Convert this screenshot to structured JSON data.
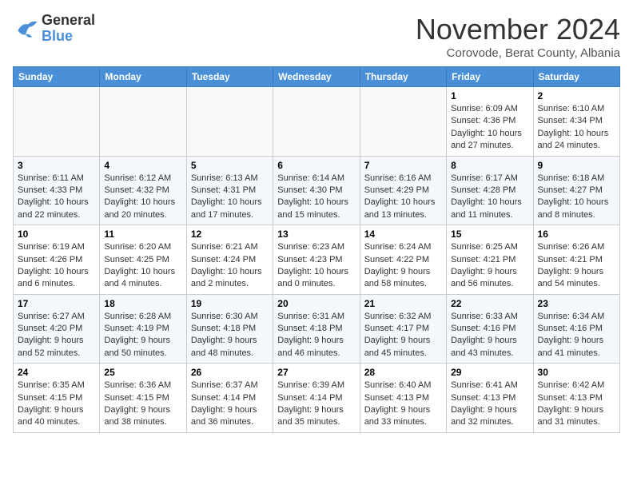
{
  "logo": {
    "line1": "General",
    "line2": "Blue"
  },
  "title": "November 2024",
  "subtitle": "Corovode, Berat County, Albania",
  "weekdays": [
    "Sunday",
    "Monday",
    "Tuesday",
    "Wednesday",
    "Thursday",
    "Friday",
    "Saturday"
  ],
  "weeks": [
    [
      {
        "day": "",
        "info": ""
      },
      {
        "day": "",
        "info": ""
      },
      {
        "day": "",
        "info": ""
      },
      {
        "day": "",
        "info": ""
      },
      {
        "day": "",
        "info": ""
      },
      {
        "day": "1",
        "info": "Sunrise: 6:09 AM\nSunset: 4:36 PM\nDaylight: 10 hours and 27 minutes."
      },
      {
        "day": "2",
        "info": "Sunrise: 6:10 AM\nSunset: 4:34 PM\nDaylight: 10 hours and 24 minutes."
      }
    ],
    [
      {
        "day": "3",
        "info": "Sunrise: 6:11 AM\nSunset: 4:33 PM\nDaylight: 10 hours and 22 minutes."
      },
      {
        "day": "4",
        "info": "Sunrise: 6:12 AM\nSunset: 4:32 PM\nDaylight: 10 hours and 20 minutes."
      },
      {
        "day": "5",
        "info": "Sunrise: 6:13 AM\nSunset: 4:31 PM\nDaylight: 10 hours and 17 minutes."
      },
      {
        "day": "6",
        "info": "Sunrise: 6:14 AM\nSunset: 4:30 PM\nDaylight: 10 hours and 15 minutes."
      },
      {
        "day": "7",
        "info": "Sunrise: 6:16 AM\nSunset: 4:29 PM\nDaylight: 10 hours and 13 minutes."
      },
      {
        "day": "8",
        "info": "Sunrise: 6:17 AM\nSunset: 4:28 PM\nDaylight: 10 hours and 11 minutes."
      },
      {
        "day": "9",
        "info": "Sunrise: 6:18 AM\nSunset: 4:27 PM\nDaylight: 10 hours and 8 minutes."
      }
    ],
    [
      {
        "day": "10",
        "info": "Sunrise: 6:19 AM\nSunset: 4:26 PM\nDaylight: 10 hours and 6 minutes."
      },
      {
        "day": "11",
        "info": "Sunrise: 6:20 AM\nSunset: 4:25 PM\nDaylight: 10 hours and 4 minutes."
      },
      {
        "day": "12",
        "info": "Sunrise: 6:21 AM\nSunset: 4:24 PM\nDaylight: 10 hours and 2 minutes."
      },
      {
        "day": "13",
        "info": "Sunrise: 6:23 AM\nSunset: 4:23 PM\nDaylight: 10 hours and 0 minutes."
      },
      {
        "day": "14",
        "info": "Sunrise: 6:24 AM\nSunset: 4:22 PM\nDaylight: 9 hours and 58 minutes."
      },
      {
        "day": "15",
        "info": "Sunrise: 6:25 AM\nSunset: 4:21 PM\nDaylight: 9 hours and 56 minutes."
      },
      {
        "day": "16",
        "info": "Sunrise: 6:26 AM\nSunset: 4:21 PM\nDaylight: 9 hours and 54 minutes."
      }
    ],
    [
      {
        "day": "17",
        "info": "Sunrise: 6:27 AM\nSunset: 4:20 PM\nDaylight: 9 hours and 52 minutes."
      },
      {
        "day": "18",
        "info": "Sunrise: 6:28 AM\nSunset: 4:19 PM\nDaylight: 9 hours and 50 minutes."
      },
      {
        "day": "19",
        "info": "Sunrise: 6:30 AM\nSunset: 4:18 PM\nDaylight: 9 hours and 48 minutes."
      },
      {
        "day": "20",
        "info": "Sunrise: 6:31 AM\nSunset: 4:18 PM\nDaylight: 9 hours and 46 minutes."
      },
      {
        "day": "21",
        "info": "Sunrise: 6:32 AM\nSunset: 4:17 PM\nDaylight: 9 hours and 45 minutes."
      },
      {
        "day": "22",
        "info": "Sunrise: 6:33 AM\nSunset: 4:16 PM\nDaylight: 9 hours and 43 minutes."
      },
      {
        "day": "23",
        "info": "Sunrise: 6:34 AM\nSunset: 4:16 PM\nDaylight: 9 hours and 41 minutes."
      }
    ],
    [
      {
        "day": "24",
        "info": "Sunrise: 6:35 AM\nSunset: 4:15 PM\nDaylight: 9 hours and 40 minutes."
      },
      {
        "day": "25",
        "info": "Sunrise: 6:36 AM\nSunset: 4:15 PM\nDaylight: 9 hours and 38 minutes."
      },
      {
        "day": "26",
        "info": "Sunrise: 6:37 AM\nSunset: 4:14 PM\nDaylight: 9 hours and 36 minutes."
      },
      {
        "day": "27",
        "info": "Sunrise: 6:39 AM\nSunset: 4:14 PM\nDaylight: 9 hours and 35 minutes."
      },
      {
        "day": "28",
        "info": "Sunrise: 6:40 AM\nSunset: 4:13 PM\nDaylight: 9 hours and 33 minutes."
      },
      {
        "day": "29",
        "info": "Sunrise: 6:41 AM\nSunset: 4:13 PM\nDaylight: 9 hours and 32 minutes."
      },
      {
        "day": "30",
        "info": "Sunrise: 6:42 AM\nSunset: 4:13 PM\nDaylight: 9 hours and 31 minutes."
      }
    ]
  ]
}
